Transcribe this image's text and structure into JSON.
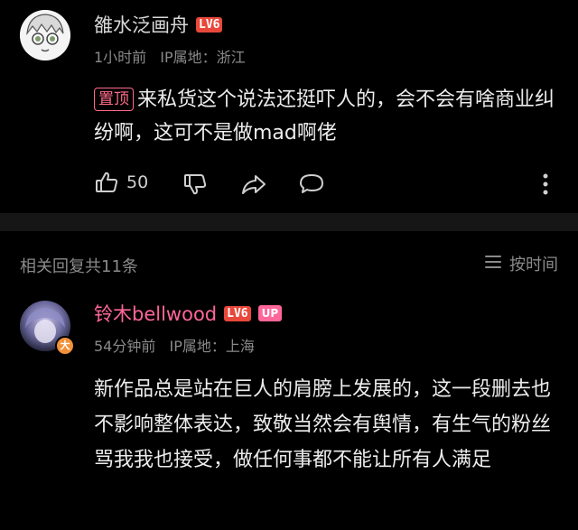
{
  "top_comment": {
    "username": "雒水泛画舟",
    "level_badge": "LV6",
    "time": "1小时前",
    "ip_label": "IP属地：浙江",
    "pinned_label": "置顶",
    "text": "来私货这个说法还挺吓人的，会不会有啥商业纠纷啊，这可不是做mad啊佬",
    "like_count": "50"
  },
  "replies_header": {
    "count_text": "相关回复共11条",
    "sort_label": "按时间"
  },
  "reply": {
    "username": "铃木bellwood",
    "level_badge": "LV6",
    "up_badge": "UP",
    "time": "54分钟前",
    "ip_label": "IP属地：上海",
    "text": "新作品总是站在巨人的肩膀上发展的，这一段删去也不影响整体表达，致敬当然会有舆情，有生气的粉丝骂我我也接受，做任何事都不能让所有人满足"
  },
  "colors": {
    "background": "#000000",
    "level_badge": "#e8483b",
    "up_badge": "#ff6699",
    "pinned": "#ff6b8a",
    "up_name": "#ff6699"
  }
}
